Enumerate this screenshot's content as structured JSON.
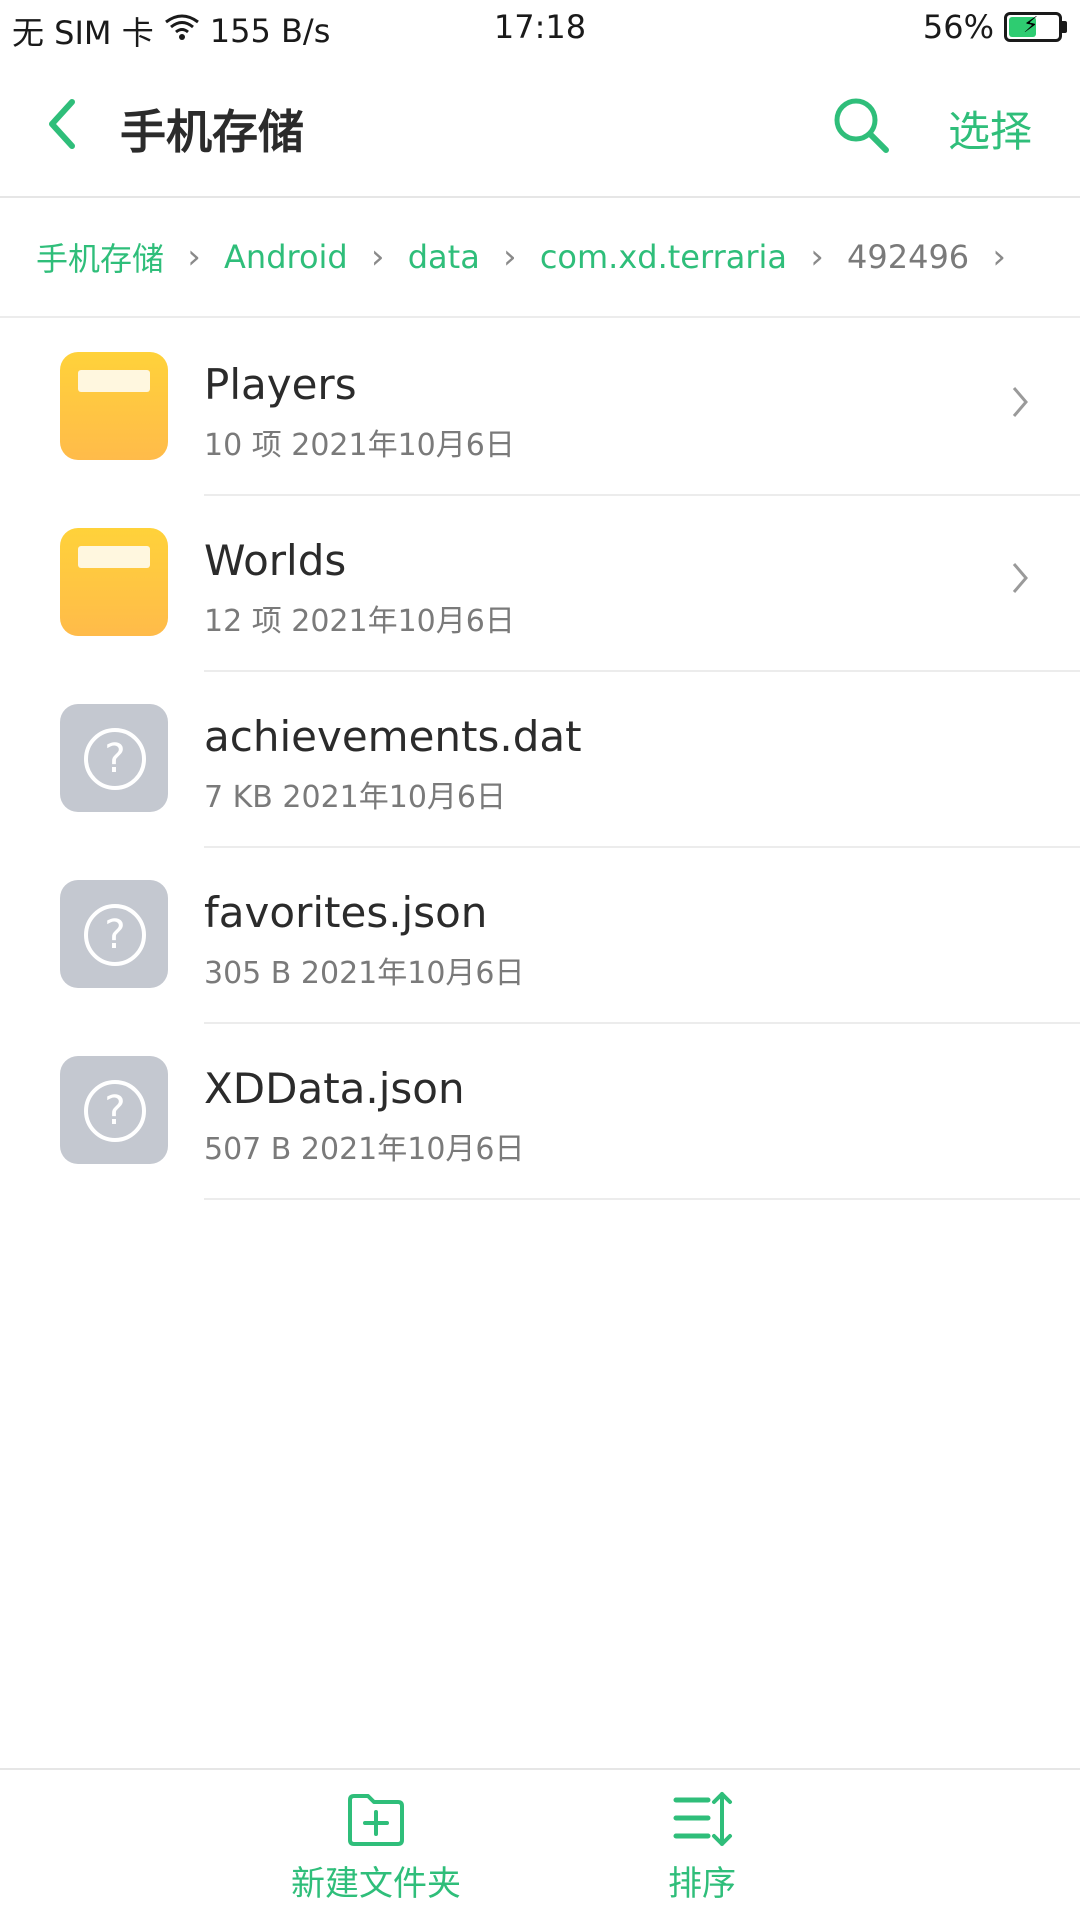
{
  "status_bar": {
    "carrier": "无 SIM 卡",
    "net_speed": "155 B/s",
    "time": "17:18",
    "battery": "56%",
    "battery_level": 0.56,
    "icons": [
      "wifi-icon",
      "battery-icon"
    ]
  },
  "header": {
    "title": "手机存储",
    "select_label": "选择",
    "icons": [
      "back-arrow-icon",
      "search-icon"
    ]
  },
  "breadcrumb": [
    {
      "label": "手机存储"
    },
    {
      "label": "Android"
    },
    {
      "label": "data"
    },
    {
      "label": "com.xd.terraria"
    },
    {
      "label": "492496"
    }
  ],
  "files": [
    {
      "name": "Players",
      "meta": "10 项  2021年10月6日",
      "type": "folder"
    },
    {
      "name": "Worlds",
      "meta": "12 项  2021年10月6日",
      "type": "folder"
    },
    {
      "name": "achievements.dat",
      "meta": "7 KB  2021年10月6日",
      "type": "unknown"
    },
    {
      "name": "favorites.json",
      "meta": "305 B  2021年10月6日",
      "type": "unknown"
    },
    {
      "name": "XDData.json",
      "meta": "507 B  2021年10月6日",
      "type": "unknown"
    }
  ],
  "bottom_bar": {
    "new_folder_label": "新建文件夹",
    "sort_label": "排序",
    "icons": [
      "new-folder-icon",
      "sort-icon"
    ]
  },
  "colors": {
    "accent": "#2fbe7a",
    "folder": "#ffc93c",
    "unknown_file": "#c4c8d0"
  }
}
